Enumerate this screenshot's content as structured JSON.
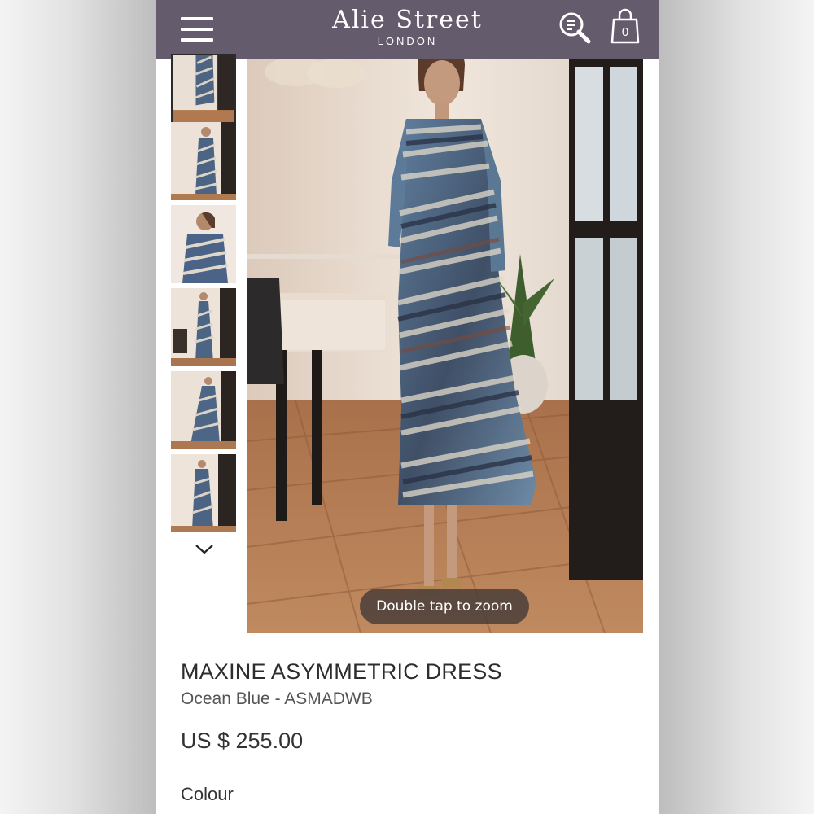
{
  "header": {
    "brand_name": "Alie Street",
    "brand_sub": "LONDON",
    "cart_count": "0",
    "background_color": "#645b6c"
  },
  "icons": {
    "menu": "hamburger-menu-icon",
    "search": "search-icon",
    "cart": "shopping-bag-icon",
    "thumbs_next": "chevron-down-icon"
  },
  "gallery": {
    "thumbnail_count": 6,
    "active_thumbnail": 1,
    "zoom_hint": "Double tap to zoom"
  },
  "product": {
    "title": "MAXINE ASYMMETRIC DRESS",
    "subtitle": "Ocean Blue - ASMADWB",
    "price": "US $ 255.00",
    "colour_label": "Colour"
  }
}
